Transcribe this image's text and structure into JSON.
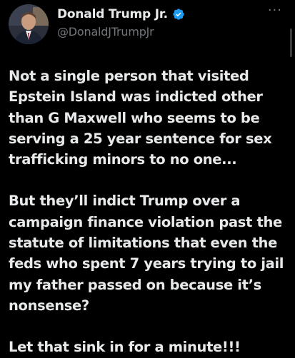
{
  "author": {
    "display_name": "Donald Trump Jr.",
    "handle": "@DonaldJTrumpJr",
    "avatar_icon": "profile-photo",
    "verified_icon": "verified-badge-icon",
    "verified_color": "#1d9bf0"
  },
  "menu": {
    "more_label": "···",
    "icon": "more-options-icon"
  },
  "tweet": {
    "lines_p1": [
      "Not a single person that visited",
      "Epstein Island was indicted other",
      "than G Maxwell who seems to be",
      "serving a 25 year sentence for sex",
      "trafficking minors to no one..."
    ],
    "lines_p2": [
      "But they’ll indict Trump over a",
      "campaign finance violation past the",
      "statute of limitations that even the",
      "feds who spent 7 years trying to jail",
      "my father passed on because it’s",
      "nonsense?"
    ],
    "lines_p3": [
      "Let that sink in for a minute!!!"
    ]
  },
  "colors": {
    "background": "#000000",
    "text": "#e7e9ea",
    "secondary": "#71767b"
  }
}
